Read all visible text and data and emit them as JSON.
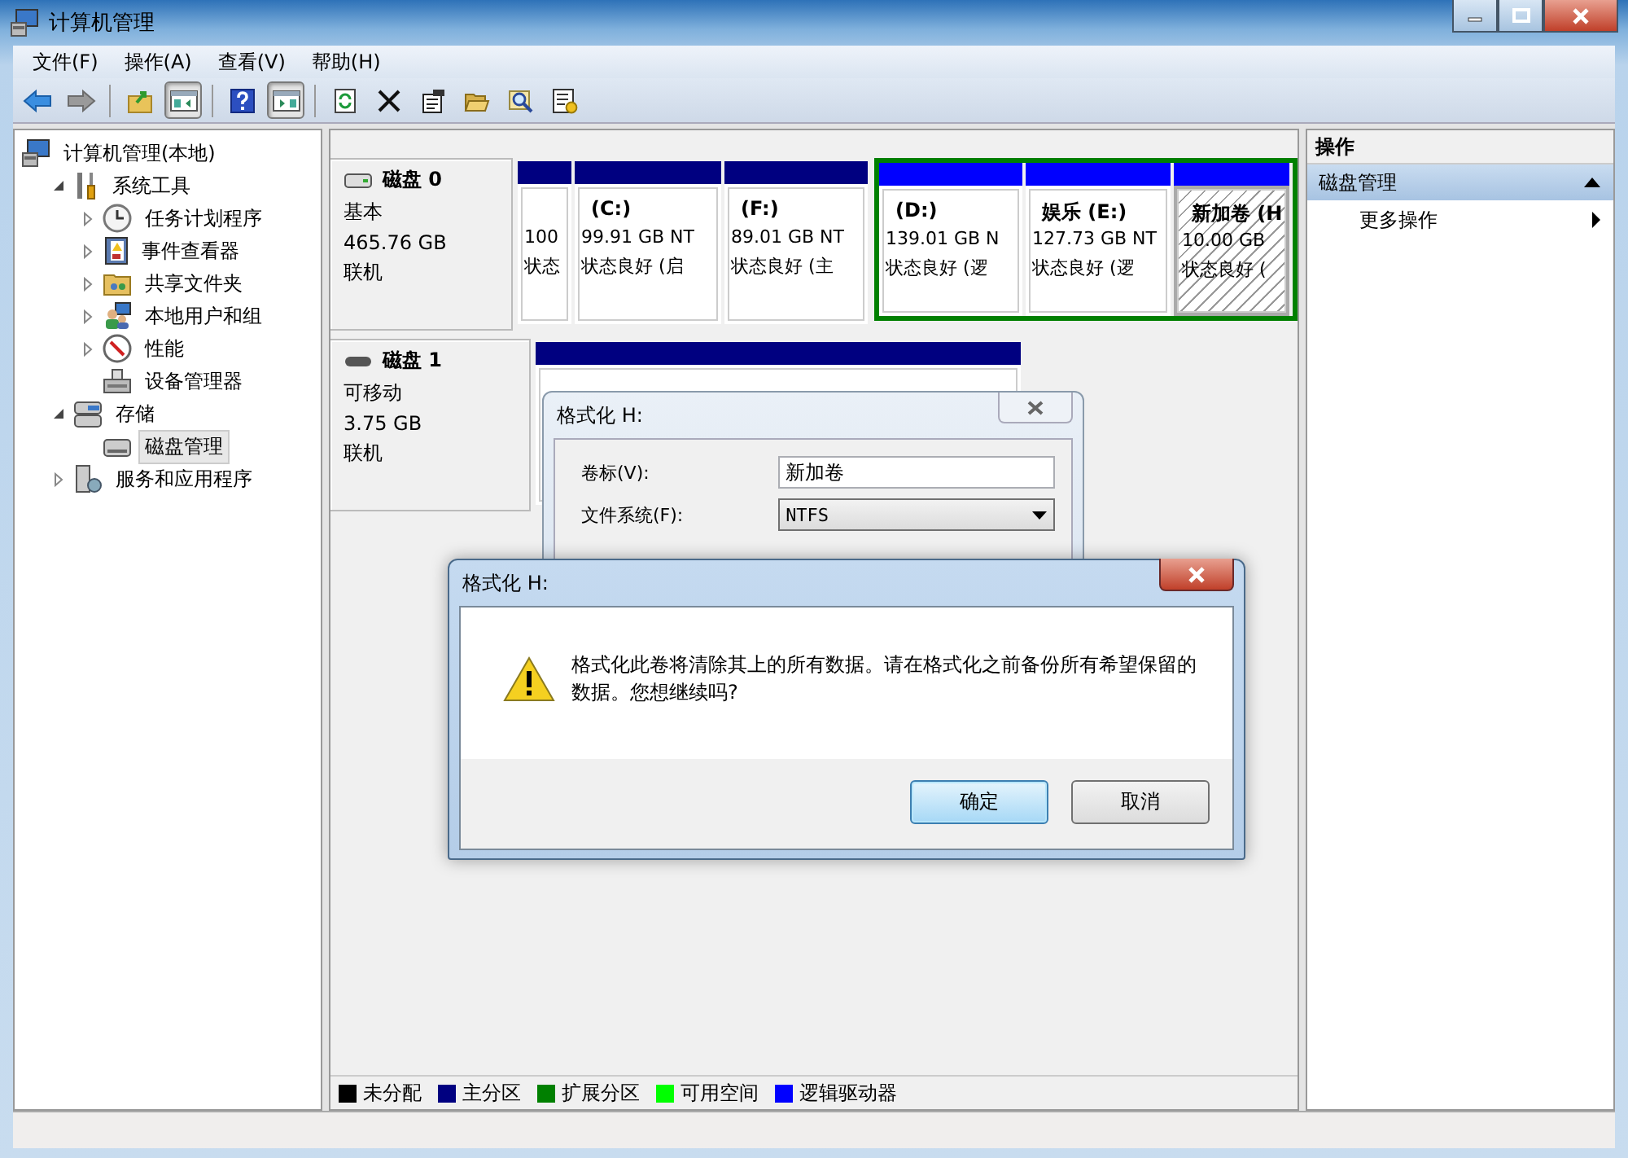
{
  "window": {
    "title": "计算机管理"
  },
  "menu": [
    {
      "label": "文件(F)"
    },
    {
      "label": "操作(A)"
    },
    {
      "label": "查看(V)"
    },
    {
      "label": "帮助(H)"
    }
  ],
  "toolbar": [
    {
      "kind": "back",
      "on": false
    },
    {
      "kind": "forward",
      "on": false
    },
    {
      "kind": "separator"
    },
    {
      "kind": "up",
      "on": false
    },
    {
      "kind": "tree",
      "on": true
    },
    {
      "kind": "separator"
    },
    {
      "kind": "help",
      "on": false
    },
    {
      "kind": "pane",
      "on": true
    },
    {
      "kind": "separator"
    },
    {
      "kind": "refresh",
      "on": false
    },
    {
      "kind": "delete",
      "on": false
    },
    {
      "kind": "properties",
      "on": false
    },
    {
      "kind": "open",
      "on": false
    },
    {
      "kind": "search",
      "on": false
    },
    {
      "kind": "settings",
      "on": false
    }
  ],
  "tree": [
    {
      "label": "计算机管理(本地)",
      "kind": "computer",
      "selected": false,
      "children": [
        {
          "label": "系统工具",
          "kind": "tools",
          "expanded": true,
          "selected": false,
          "children": [
            {
              "label": "任务计划程序",
              "kind": "clock",
              "expanded": false,
              "selected": false
            },
            {
              "label": "事件查看器",
              "kind": "log",
              "expanded": false,
              "selected": false
            },
            {
              "label": "共享文件夹",
              "kind": "share",
              "expanded": false,
              "selected": false
            },
            {
              "label": "本地用户和组",
              "kind": "users",
              "expanded": false,
              "selected": false
            },
            {
              "label": "性能",
              "kind": "gauge",
              "expanded": false,
              "selected": false
            },
            {
              "label": "设备管理器",
              "kind": "device",
              "selected": false
            }
          ]
        },
        {
          "label": "存储",
          "kind": "storage",
          "expanded": true,
          "selected": false,
          "children": [
            {
              "label": "磁盘管理",
              "kind": "disk",
              "selected": true
            }
          ]
        },
        {
          "label": "服务和应用程序",
          "kind": "services",
          "expanded": false,
          "selected": false
        }
      ]
    }
  ],
  "disks": [
    {
      "name": "磁盘 0",
      "kind": "fixed",
      "type": "基本",
      "size": "465.76 GB",
      "status": "联机",
      "partitions": [
        {
          "kind": "primary",
          "size": "100",
          "status": "状态",
          "selected": false
        },
        {
          "kind": "primary",
          "label": "(C:)",
          "size": "99.91 GB NT",
          "status": "状态良好 (启",
          "selected": false
        },
        {
          "kind": "primary",
          "label": "(F:)",
          "size": "89.01 GB NT",
          "status": "状态良好 (主",
          "selected": false
        },
        {
          "kind": "logical",
          "label": "(D:)",
          "size": "139.01 GB N",
          "status": "状态良好 (逻",
          "selected": false
        },
        {
          "kind": "logical",
          "label": "娱乐  (E:)",
          "size": "127.73 GB NT",
          "status": "状态良好 (逻",
          "selected": false
        },
        {
          "kind": "logical",
          "label": "新加卷  (H",
          "size": "10.00 GB",
          "status": "状态良好 (",
          "selected": true
        }
      ]
    },
    {
      "name": "磁盘 1",
      "kind": "removable",
      "type": "可移动",
      "size": "3.75 GB",
      "status": "联机",
      "partitions": [
        {
          "kind": "primary",
          "selected": false
        }
      ]
    }
  ],
  "legend": [
    {
      "label": "未分配",
      "color": "#000000"
    },
    {
      "label": "主分区",
      "color": "#000080"
    },
    {
      "label": "扩展分区",
      "color": "#008000"
    },
    {
      "label": "可用空间",
      "color": "#00ff00"
    },
    {
      "label": "逻辑驱动器",
      "color": "#0000ff"
    }
  ],
  "actions": {
    "title": "操作",
    "sections": [
      {
        "title": "磁盘管理",
        "expanded": true,
        "items": [
          {
            "label": "更多操作"
          }
        ]
      }
    ]
  },
  "format_dialog": {
    "title": "格式化 H:",
    "fields": [
      {
        "label": "卷标(V):",
        "kind": "text",
        "value": "新加卷"
      },
      {
        "label": "文件系统(F):",
        "kind": "select",
        "value": "NTFS"
      }
    ]
  },
  "confirm_dialog": {
    "title": "格式化 H:",
    "message": "格式化此卷将清除其上的所有数据。请在格式化之前备份所有希望保留的数据。您想继续吗?",
    "buttons": [
      {
        "label": "确定",
        "default": true
      },
      {
        "label": "取消",
        "default": false
      }
    ]
  }
}
